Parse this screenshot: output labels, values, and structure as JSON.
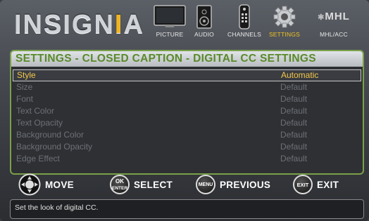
{
  "header": {
    "logo_prefix": "INSIGN",
    "logo_i": "I",
    "logo_suffix": "A",
    "nav": [
      {
        "label": "PICTURE",
        "icon": "tv-icon",
        "active": false
      },
      {
        "label": "AUDIO",
        "icon": "speaker-icon",
        "active": false
      },
      {
        "label": "CHANNELS",
        "icon": "remote-icon",
        "active": false
      },
      {
        "label": "SETTINGS",
        "icon": "gear-icon",
        "active": true
      },
      {
        "label": "MHL/ACC",
        "icon": "mhl-logo-icon",
        "active": false
      }
    ],
    "mhl_logo_text": "MHL"
  },
  "panel": {
    "title": "SETTINGS - CLOSED CAPTION - DIGITAL CC SETTINGS",
    "rows": [
      {
        "label": "Style",
        "value": "Automatic",
        "selected": true
      },
      {
        "label": "Size",
        "value": "Default"
      },
      {
        "label": "Font",
        "value": "Default"
      },
      {
        "label": "Text Color",
        "value": "Default"
      },
      {
        "label": "Text Opacity",
        "value": "Default"
      },
      {
        "label": "Background Color",
        "value": "Default"
      },
      {
        "label": "Background Opacity",
        "value": "Default"
      },
      {
        "label": "Edge Effect",
        "value": "Default"
      }
    ]
  },
  "hints": {
    "move": "MOVE",
    "ok_top": "OK",
    "ok_bottom": "ENTER",
    "select": "SELECT",
    "menu_btn": "MENU",
    "previous": "PREVIOUS",
    "exit_btn": "EXIT",
    "exit": "EXIT"
  },
  "help_text": "Set the look of digital CC.",
  "colors": {
    "accent_green": "#7aa04a",
    "selected_yellow": "#f3c74a",
    "logo_orange": "#f0b51e"
  }
}
